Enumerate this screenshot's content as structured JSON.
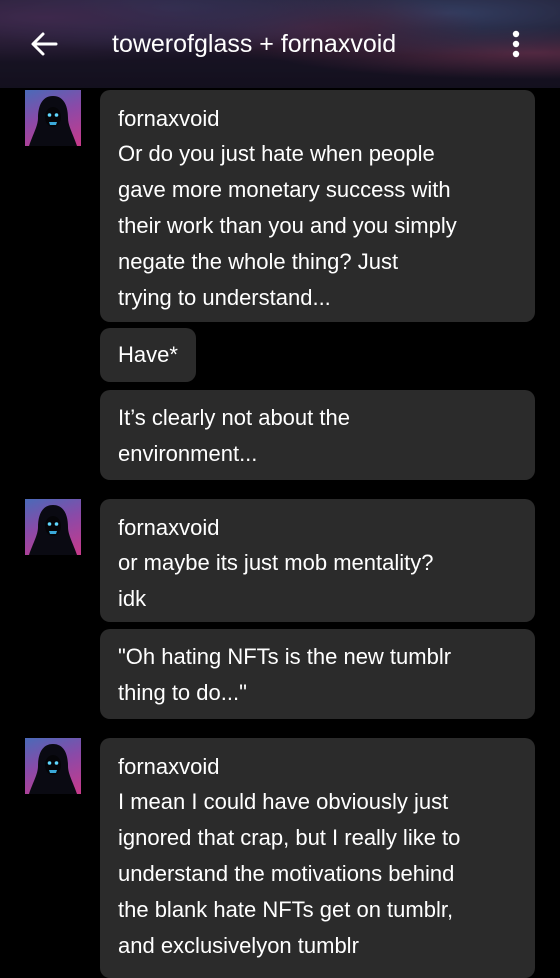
{
  "header": {
    "title": "towerofglass + fornaxvoid",
    "back_icon": "arrow-left-icon",
    "menu_icon": "more-vertical-icon"
  },
  "messages": [
    {
      "sender": "fornaxvoid",
      "lines": [
        "Or do you just hate when people",
        "gave more monetary success with",
        "their work than you and you simply",
        "negate the whole thing? Just",
        "trying to understand..."
      ]
    },
    {
      "lines": [
        "Have*"
      ]
    },
    {
      "lines": [
        "It’s clearly not about the",
        "environment..."
      ]
    },
    {
      "sender": "fornaxvoid",
      "lines": [
        "or maybe its just mob mentality?",
        "idk"
      ]
    },
    {
      "lines": [
        "\"Oh hating NFTs is the new tumblr",
        "thing to do...\""
      ]
    },
    {
      "sender": "fornaxvoid",
      "lines": [
        "I mean I could have obviously just",
        "ignored that crap, but I really like to",
        "understand the motivations behind",
        "the blank hate NFTs get on tumblr,",
        "and exclusivelyon tumblr"
      ]
    }
  ]
}
